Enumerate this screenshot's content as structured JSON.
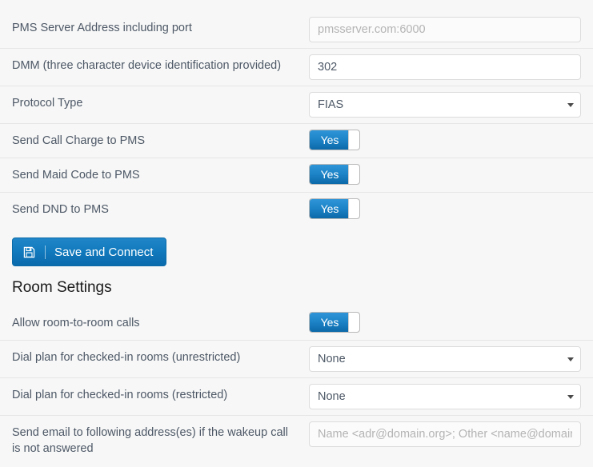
{
  "pms_section": {
    "rows": [
      {
        "label": "PMS Server Address including port",
        "type": "text",
        "value": "",
        "placeholder": "pmsserver.com:6000"
      },
      {
        "label": "DMM (three character device identification provided)",
        "type": "text",
        "value": "302",
        "placeholder": ""
      },
      {
        "label": "Protocol Type",
        "type": "select",
        "value": "FIAS"
      },
      {
        "label": "Send Call Charge to PMS",
        "type": "toggle",
        "value": "Yes"
      },
      {
        "label": "Send Maid Code to PMS",
        "type": "toggle",
        "value": "Yes"
      },
      {
        "label": "Send DND to PMS",
        "type": "toggle",
        "value": "Yes"
      }
    ]
  },
  "save_button": {
    "label": "Save and Connect",
    "icon": "save-icon"
  },
  "room_section": {
    "heading": "Room Settings",
    "rows": [
      {
        "label": "Allow room-to-room calls",
        "type": "toggle",
        "value": "Yes"
      },
      {
        "label": "Dial plan for checked-in rooms (unrestricted)",
        "type": "select",
        "value": "None"
      },
      {
        "label": "Dial plan for checked-in rooms (restricted)",
        "type": "select",
        "value": "None"
      },
      {
        "label": "Send email to following address(es) if the wakeup call is not answered",
        "type": "text",
        "value": "",
        "placeholder": "Name <adr@domain.org>; Other <name@domain.org>"
      }
    ]
  },
  "colors": {
    "accent": "#1179bd",
    "page_background": "#f7f7f7",
    "row_divider": "#e6e6e6",
    "label_text": "#4d5866",
    "heading_text": "#1b1b1b",
    "placeholder_text": "#b4b4b4"
  }
}
